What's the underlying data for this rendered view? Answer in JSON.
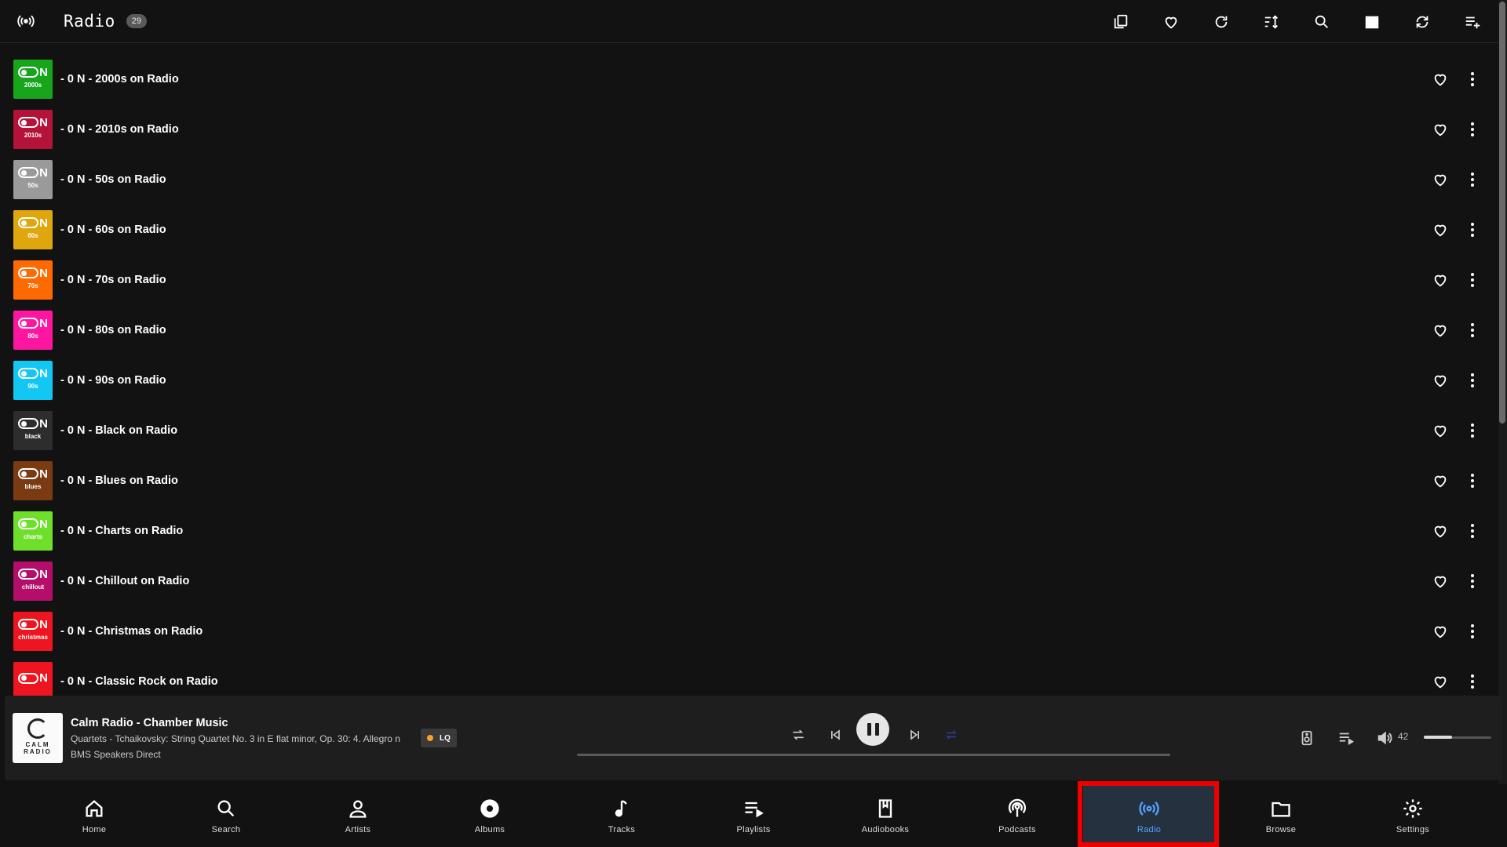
{
  "header": {
    "title": "Radio",
    "count": "29",
    "actions": [
      {
        "name": "select-mode-icon"
      },
      {
        "name": "favorites-filter-icon"
      },
      {
        "name": "refresh-icon"
      },
      {
        "name": "sort-icon"
      },
      {
        "name": "search-icon"
      },
      {
        "name": "list-view-icon"
      },
      {
        "name": "sync-icon"
      },
      {
        "name": "add-to-queue-icon"
      }
    ]
  },
  "stations": [
    {
      "name": "- 0 N - 2000s on Radio",
      "era": "2000s",
      "color": "#17a51c"
    },
    {
      "name": "- 0 N - 2010s on Radio",
      "era": "2010s",
      "color": "#b5123a"
    },
    {
      "name": "- 0 N - 50s on Radio",
      "era": "50s",
      "color": "#9a9a9a"
    },
    {
      "name": "- 0 N - 60s on Radio",
      "era": "60s",
      "color": "#dfa60e"
    },
    {
      "name": "- 0 N - 70s on Radio",
      "era": "70s",
      "color": "#ff6a00"
    },
    {
      "name": "- 0 N - 80s on Radio",
      "era": "80s",
      "color": "#ff16a0"
    },
    {
      "name": "- 0 N - 90s on Radio",
      "era": "90s",
      "color": "#12c7f3"
    },
    {
      "name": "- 0 N - Black on Radio",
      "era": "black",
      "color": "#2d2d2d"
    },
    {
      "name": "- 0 N - Blues on Radio",
      "era": "blues",
      "color": "#7a3b12"
    },
    {
      "name": "- 0 N - Charts on Radio",
      "era": "charts",
      "color": "#6fe02a"
    },
    {
      "name": "- 0 N - Chillout on Radio",
      "era": "chillout",
      "color": "#b40e6a"
    },
    {
      "name": "- 0 N - Christmas on Radio",
      "era": "christmas",
      "color": "#ee1520"
    },
    {
      "name": "- 0 N - Classic Rock on Radio",
      "era": "",
      "color": "#ee1520"
    }
  ],
  "player": {
    "station": "Calm Radio - Chamber Music",
    "track": "Quartets - Tchaikovsky: String Quartet No. 3 in E flat minor, Op. 30: 4. Allegro n",
    "speaker": "BMS Speakers Direct",
    "cover_text": "CALM RADIO",
    "quality": "LQ",
    "quality_dot_color": "#f5a623",
    "volume": "42",
    "volume_fraction": 0.42
  },
  "nav": [
    {
      "label": "Home",
      "icon": "home-icon"
    },
    {
      "label": "Search",
      "icon": "search-icon"
    },
    {
      "label": "Artists",
      "icon": "person-icon"
    },
    {
      "label": "Albums",
      "icon": "disc-icon"
    },
    {
      "label": "Tracks",
      "icon": "music-note-icon"
    },
    {
      "label": "Playlists",
      "icon": "playlist-icon"
    },
    {
      "label": "Audiobooks",
      "icon": "audiobook-icon"
    },
    {
      "label": "Podcasts",
      "icon": "podcast-icon"
    },
    {
      "label": "Radio",
      "icon": "radio-icon",
      "active": true
    },
    {
      "label": "Browse",
      "icon": "folder-icon"
    },
    {
      "label": "Settings",
      "icon": "gear-icon"
    }
  ],
  "colors": {
    "background": "#121212",
    "accent": "#4fa3ff",
    "highlight": "#ee0000"
  }
}
